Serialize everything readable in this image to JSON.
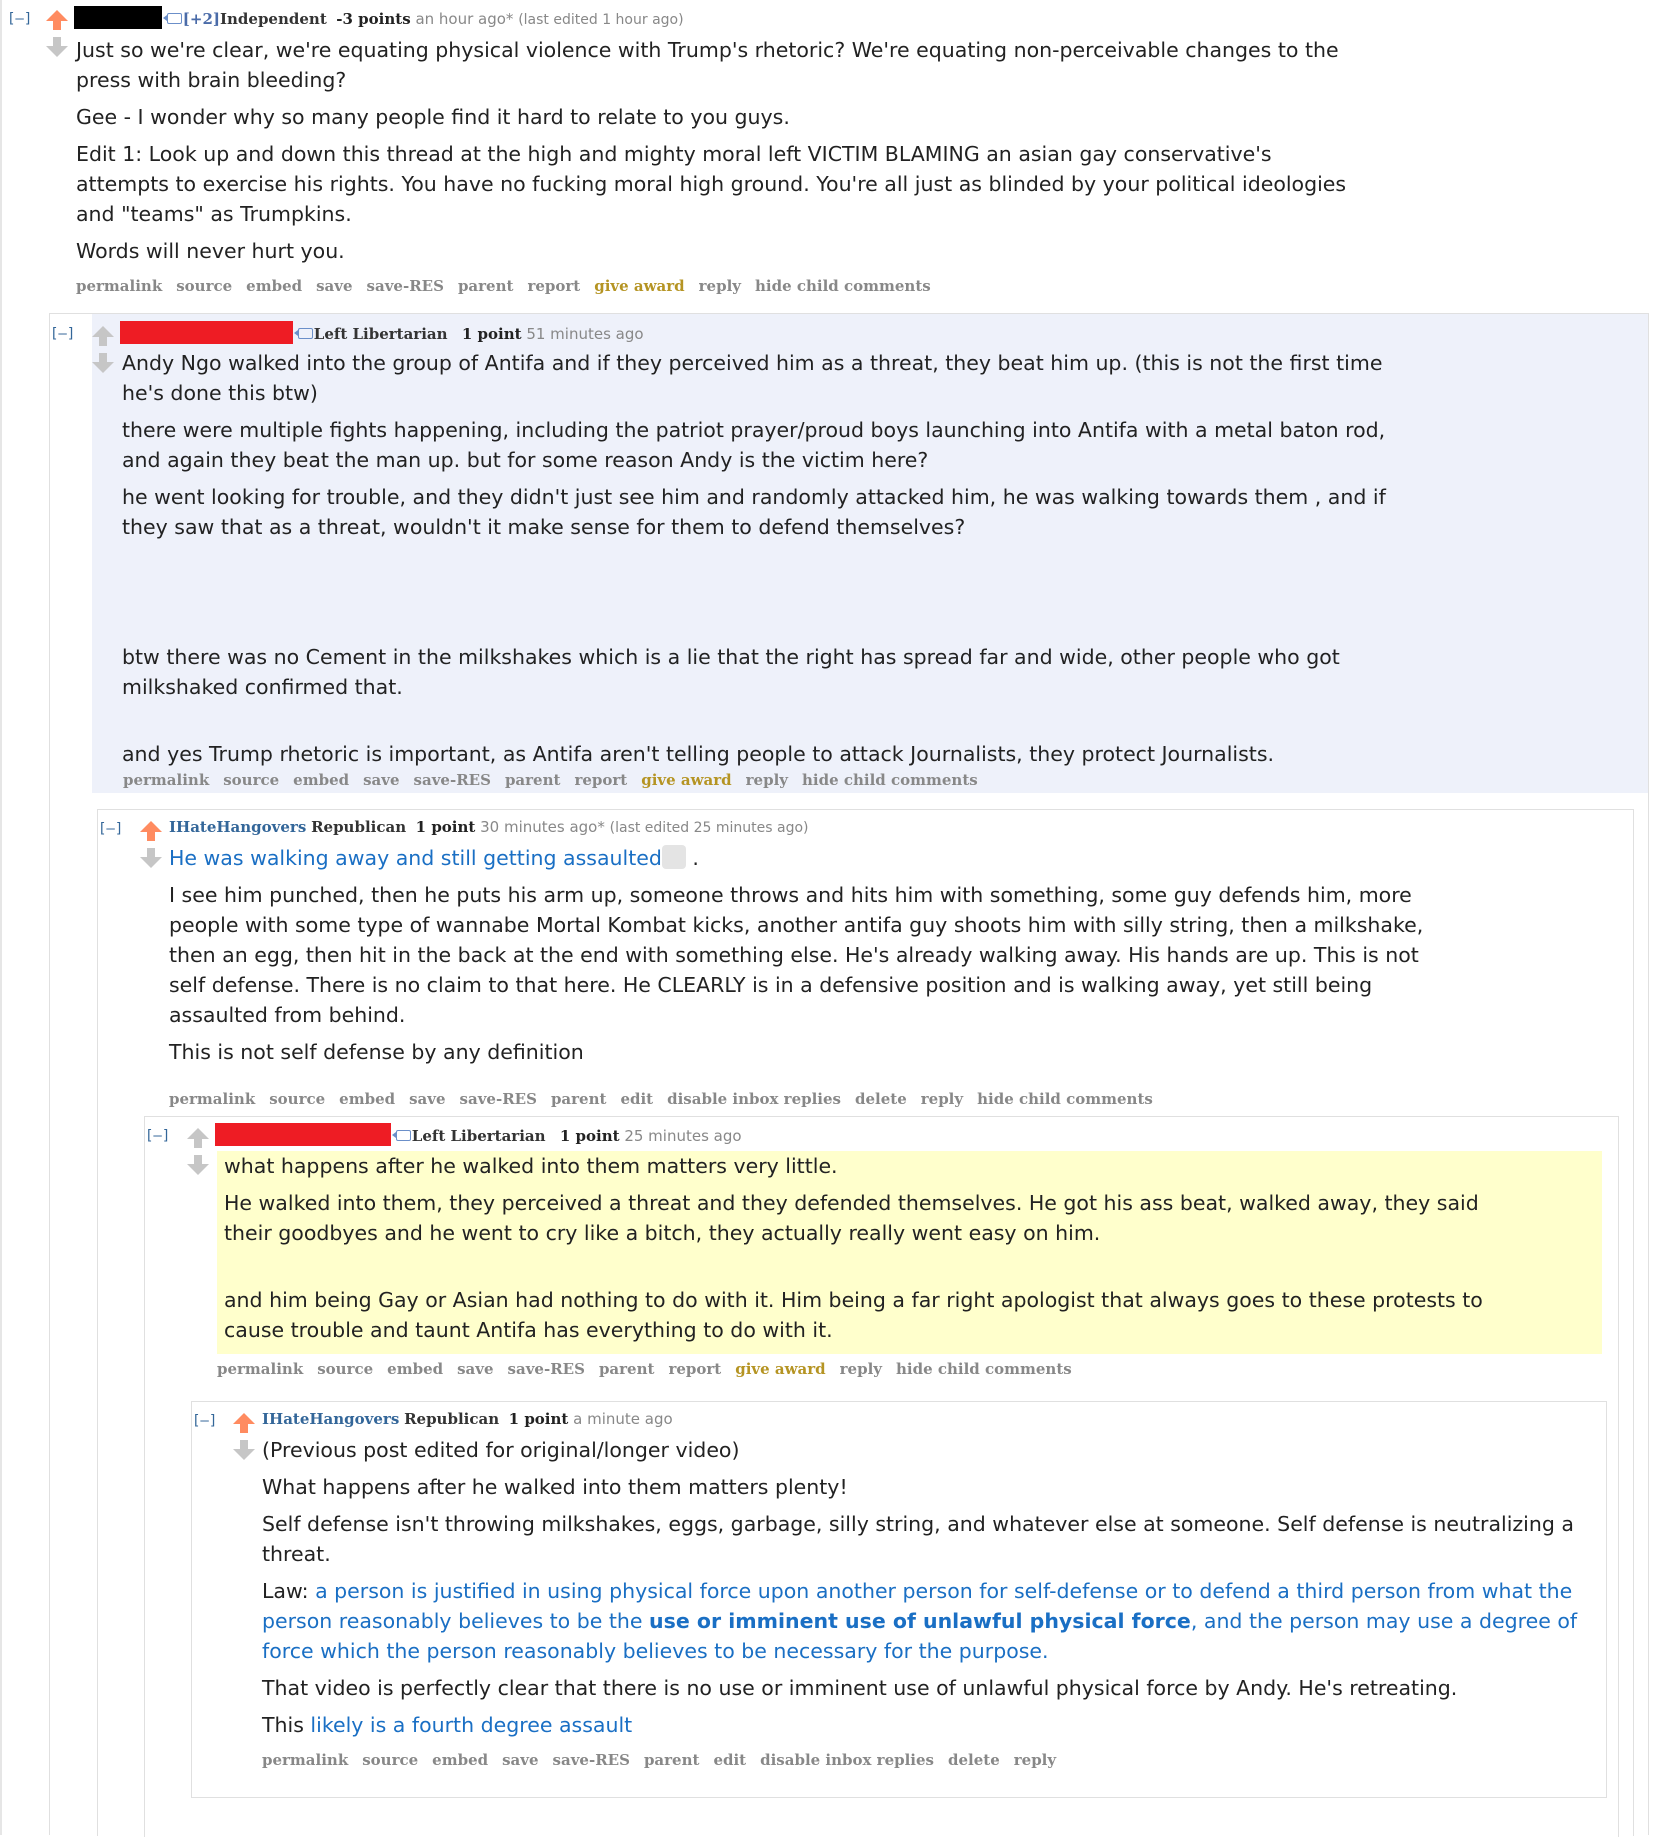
{
  "colors": {
    "upvote": "#ff8b60",
    "downvote": "#c6c6c6",
    "link": "#1a6fc4",
    "award": "#b59423",
    "highlight_blue": "#eef1fa",
    "highlight_yellow": "#ffffcc"
  },
  "toggle_label": "[–]",
  "c1": {
    "flair_prefix": "[+2]",
    "flair": "Independent",
    "score": "-3 points",
    "time": "an hour ago*",
    "edited": "(last edited 1 hour ago)",
    "paras": [
      "Just so we're clear, we're equating physical violence with Trump's rhetoric? We're equating non-perceivable changes to the press with brain bleeding?",
      "Gee - I wonder why so many people find it hard to relate to you guys.",
      "Edit 1: Look up and down this thread at the high and mighty moral left VICTIM BLAMING an asian gay conservative's attempts to exercise his rights. You have no fucking moral high ground. You're all just as blinded by your political ideologies and \"teams\" as Trumpkins.",
      "Words will never hurt you."
    ],
    "actions": [
      "permalink",
      "source",
      "embed",
      "save",
      "save-RES",
      "parent",
      "report",
      "give award",
      "reply",
      "hide child comments"
    ]
  },
  "c2": {
    "flair": "Left Libertarian",
    "score": "1 point",
    "time": "51 minutes ago",
    "p1": "Andy Ngo walked into the group of Antifa and if they perceived him as a threat, they beat him up. (this is not the first time he's done this btw)",
    "p2": "there were multiple fights happening, including the patriot prayer/proud boys launching into Antifa with a metal baton rod, and again they beat the man up. but for some reason Andy is the victim here?",
    "p3": "he went looking for trouble, and they didn't just see him and randomly attacked him, he was walking towards them , and if they saw that as a threat, wouldn't it make sense for them to defend themselves?",
    "p4": "btw there was no Cement in the milkshakes which is a lie that the right has spread far and wide, other people who got milkshaked confirmed that.",
    "p5": "and yes Trump rhetoric is important, as Antifa aren't telling people to attack Journalists, they protect Journalists.",
    "actions": [
      "permalink",
      "source",
      "embed",
      "save",
      "save-RES",
      "parent",
      "report",
      "give award",
      "reply",
      "hide child comments"
    ]
  },
  "c3": {
    "author": "IHateHangovers",
    "flair": "Republican",
    "score": "1 point",
    "time": "30 minutes ago*",
    "edited": "(last edited 25 minutes ago)",
    "link_text": "He was walking away and still getting assaulted",
    "after_link": " .",
    "p2": "I see him punched, then he puts his arm up, someone throws and hits him with something, some guy defends him, more people with some type of wannabe Mortal Kombat kicks, another antifa guy shoots him with silly string, then a milkshake, then an egg, then hit in the back at the end with something else. He's already walking away. His hands are up. This is not self defense. There is no claim to that here. He CLEARLY is in a defensive position and is walking away, yet still being assaulted from behind.",
    "p3": "This is not self defense by any definition",
    "actions": [
      "permalink",
      "source",
      "embed",
      "save",
      "save-RES",
      "parent",
      "edit",
      "disable inbox replies",
      "delete",
      "reply",
      "hide child comments"
    ]
  },
  "c4": {
    "flair": "Left Libertarian",
    "score": "1 point",
    "time": "25 minutes ago",
    "p1": "what happens after he walked into them matters very little.",
    "p2": "He walked into them, they perceived a threat and they defended themselves. He got his ass beat, walked away, they said their goodbyes and he went to cry like a bitch, they actually really went easy on him.",
    "p3": "and him being Gay or Asian had nothing to do with it. Him being a far right apologist that always goes to these protests to cause trouble and taunt Antifa has everything to do with it.",
    "actions": [
      "permalink",
      "source",
      "embed",
      "save",
      "save-RES",
      "parent",
      "report",
      "give award",
      "reply",
      "hide child comments"
    ]
  },
  "c5": {
    "author": "IHateHangovers",
    "flair": "Republican",
    "score": "1 point",
    "time": "a minute ago",
    "p1": "(Previous post edited for original/longer video)",
    "p2": "What happens after he walked into them matters plenty!",
    "p3": "Self defense isn't throwing milkshakes, eggs, garbage, silly string, and whatever else at someone. Self defense is neutralizing a threat.",
    "law_label": "Law: ",
    "law_a": "a person is justified in using physical force upon another person for self-defense or to defend a third person from what the person reasonably believes to be the ",
    "law_b": "use or imminent use of unlawful physical force",
    "law_c": ", and the person may use a degree of force which the person reasonably believes to be necessary for the purpose.",
    "p5": "That video is perfectly clear that there is no use or imminent use of unlawful physical force by Andy. He's retreating.",
    "p6_prefix": "This ",
    "p6_link": "likely is a fourth degree assault",
    "actions": [
      "permalink",
      "source",
      "embed",
      "save",
      "save-RES",
      "parent",
      "edit",
      "disable inbox replies",
      "delete",
      "reply"
    ]
  }
}
